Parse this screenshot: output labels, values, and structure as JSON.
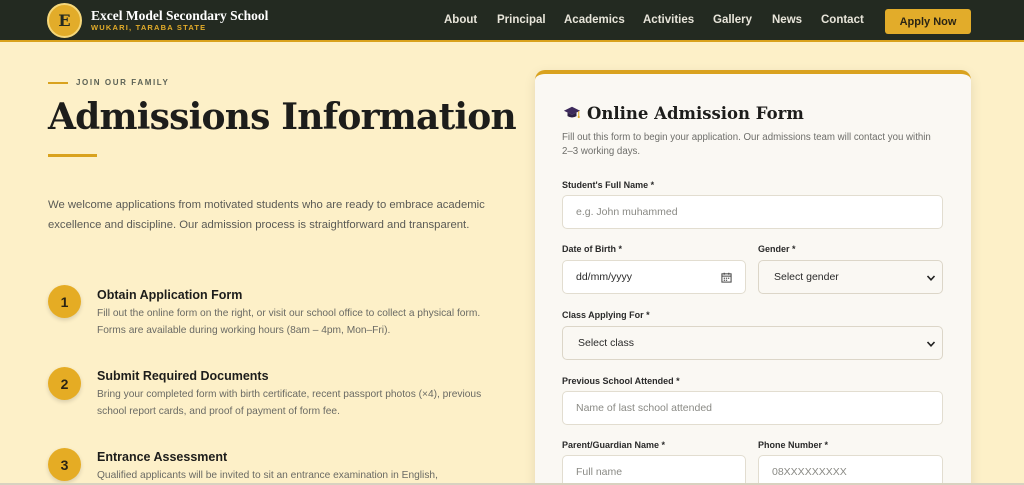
{
  "header": {
    "logo_letter": "E",
    "school_name": "Excel Model Secondary School",
    "location": "WUKARI, TARABA STATE",
    "nav": [
      "About",
      "Principal",
      "Academics",
      "Activities",
      "Gallery",
      "News",
      "Contact"
    ],
    "cta": "Apply Now"
  },
  "colors": {
    "header_bg": "#232a21",
    "accent": "#e2ac2a",
    "page_bg": "#fdf0c8"
  },
  "hero": {
    "eyebrow": "JOIN OUR FAMILY",
    "title": "Admissions Information",
    "intro": "We welcome applications from motivated students who are ready to embrace academic excellence and discipline. Our admission process is straightforward and transparent."
  },
  "steps": [
    {
      "number": "1",
      "title": "Obtain Application Form",
      "text": "Fill out the online form on the right, or visit our school office to collect a physical form. Forms are available during working hours (8am – 4pm, Mon–Fri)."
    },
    {
      "number": "2",
      "title": "Submit Required Documents",
      "text": "Bring your completed form with birth certificate, recent passport photos (×4), previous school report cards, and proof of payment of form fee."
    },
    {
      "number": "3",
      "title": "Entrance Assessment",
      "text": "Qualified applicants will be invited to sit an entrance examination in English,"
    }
  ],
  "form": {
    "icon": "graduation-cap-icon",
    "title": "Online Admission Form",
    "subtitle": "Fill out this form to begin your application. Our admissions team will contact you within 2–3 working days.",
    "full_name": {
      "label": "Student's Full Name *",
      "placeholder": "e.g. John muhammed"
    },
    "dob": {
      "label": "Date of Birth *",
      "value": "dd/mm/yyyy"
    },
    "gender": {
      "label": "Gender *",
      "value": "Select gender"
    },
    "class": {
      "label": "Class Applying For *",
      "value": "Select class"
    },
    "previous_school": {
      "label": "Previous School Attended *",
      "placeholder": "Name of last school attended"
    },
    "guardian": {
      "label": "Parent/Guardian Name *",
      "placeholder": "Full name"
    },
    "phone": {
      "label": "Phone Number *",
      "placeholder": "08XXXXXXXXX"
    }
  }
}
